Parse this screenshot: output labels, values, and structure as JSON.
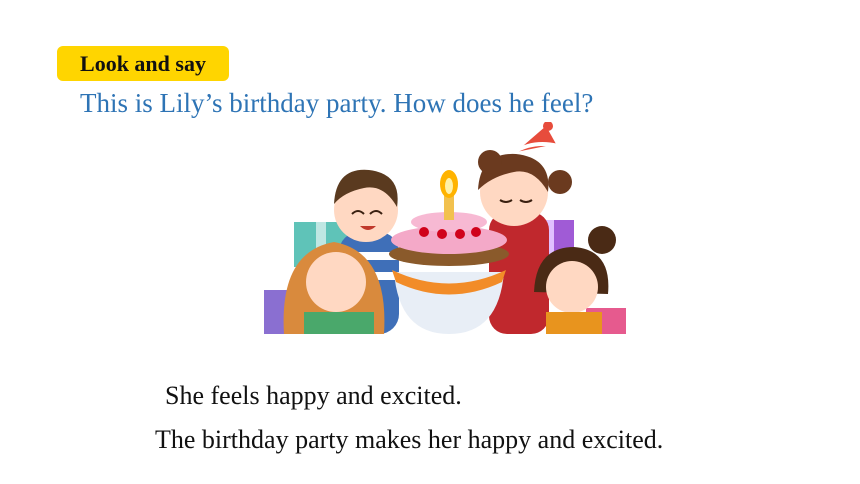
{
  "slide": {
    "badge_label": "Look and say",
    "question": "This is Lily’s birthday party. How does he feel?",
    "answers": [
      "She feels happy and excited.",
      "The birthday party makes her happy and excited."
    ]
  },
  "illustration": {
    "subject": "birthday-party-scene",
    "colors": {
      "badge": "#ffd500",
      "question_text": "#2e74b5"
    }
  }
}
